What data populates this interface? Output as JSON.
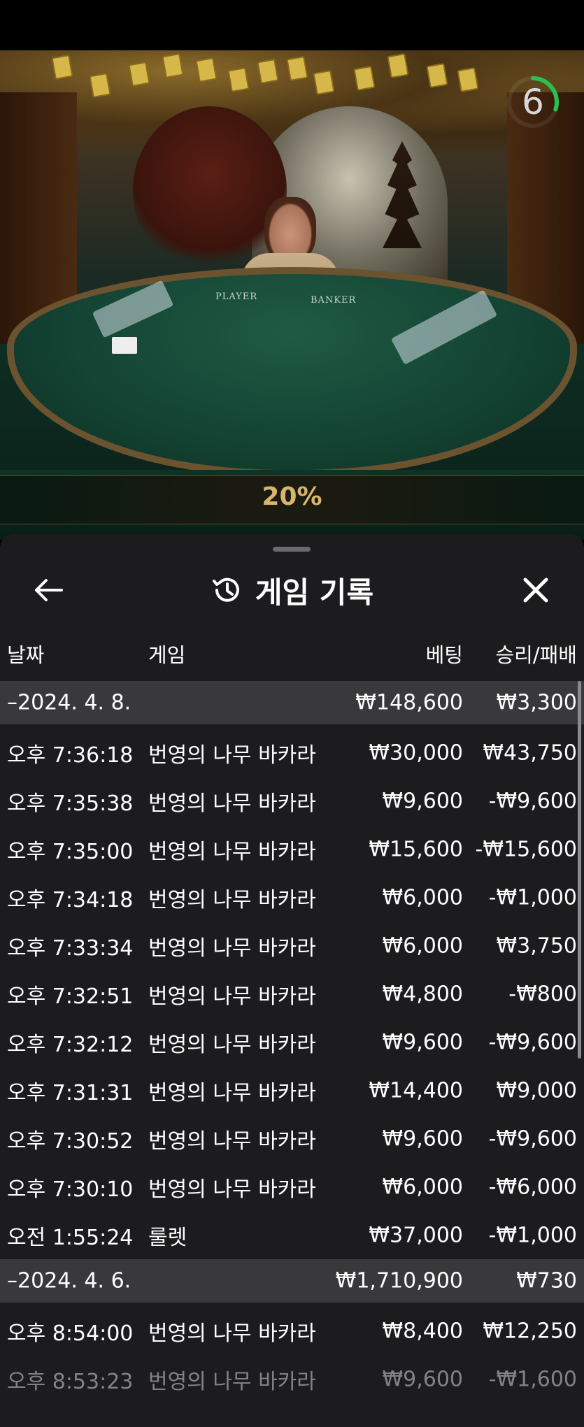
{
  "video": {
    "countdown": "6",
    "countdown_fraction": 0.3,
    "table_labels": [
      "PLAYER",
      "BANKER"
    ],
    "percent_banner": "20%"
  },
  "panel": {
    "title": "게임 기록",
    "back_icon": "arrow-left-icon",
    "history_icon": "history-clock-icon",
    "close_icon": "close-x-icon"
  },
  "columns": {
    "date": "날짜",
    "game": "게임",
    "bet": "베팅",
    "win_loss": "승리/패배"
  },
  "groups": [
    {
      "date": "–2024. 4. 8.",
      "total_bet": "₩148,600",
      "total_result": "₩3,300",
      "rows": [
        {
          "time": "오후 7:36:18",
          "game": "번영의 나무 바카라",
          "bet": "₩30,000",
          "result": "₩43,750"
        },
        {
          "time": "오후 7:35:38",
          "game": "번영의 나무 바카라",
          "bet": "₩9,600",
          "result": "-₩9,600"
        },
        {
          "time": "오후 7:35:00",
          "game": "번영의 나무 바카라",
          "bet": "₩15,600",
          "result": "-₩15,600"
        },
        {
          "time": "오후 7:34:18",
          "game": "번영의 나무 바카라",
          "bet": "₩6,000",
          "result": "-₩1,000"
        },
        {
          "time": "오후 7:33:34",
          "game": "번영의 나무 바카라",
          "bet": "₩6,000",
          "result": "₩3,750"
        },
        {
          "time": "오후 7:32:51",
          "game": "번영의 나무 바카라",
          "bet": "₩4,800",
          "result": "-₩800"
        },
        {
          "time": "오후 7:32:12",
          "game": "번영의 나무 바카라",
          "bet": "₩9,600",
          "result": "-₩9,600"
        },
        {
          "time": "오후 7:31:31",
          "game": "번영의 나무 바카라",
          "bet": "₩14,400",
          "result": "₩9,000"
        },
        {
          "time": "오후 7:30:52",
          "game": "번영의 나무 바카라",
          "bet": "₩9,600",
          "result": "-₩9,600"
        },
        {
          "time": "오후 7:30:10",
          "game": "번영의 나무 바카라",
          "bet": "₩6,000",
          "result": "-₩6,000"
        },
        {
          "time": "오전 1:55:24",
          "game": "룰렛",
          "bet": "₩37,000",
          "result": "-₩1,000"
        }
      ]
    },
    {
      "date": "–2024. 4. 6.",
      "total_bet": "₩1,710,900",
      "total_result": "₩730",
      "rows": [
        {
          "time": "오후 8:54:00",
          "game": "번영의 나무 바카라",
          "bet": "₩8,400",
          "result": "₩12,250"
        },
        {
          "time": "오후 8:53:23",
          "game": "번영의 나무 바카라",
          "bet": "₩9,600",
          "result": "-₩1,600"
        }
      ]
    }
  ]
}
